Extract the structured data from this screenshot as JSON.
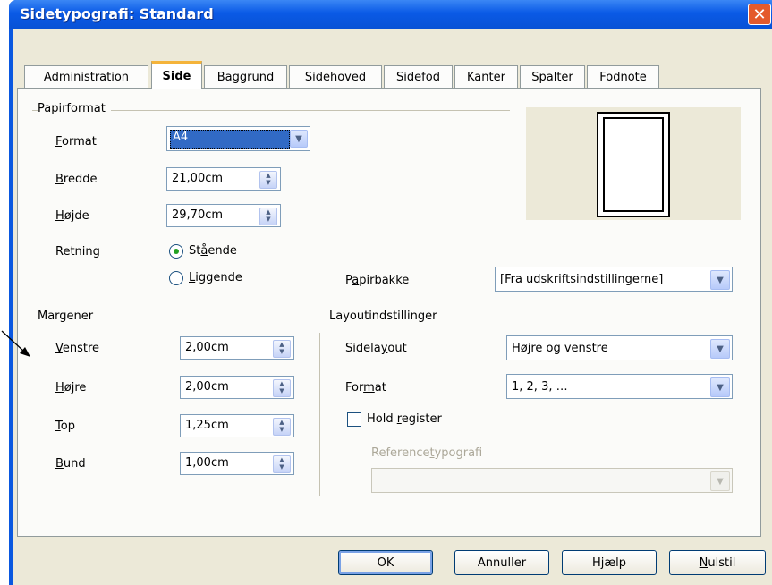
{
  "window": {
    "title": "Sidetypografi: Standard",
    "close_glyph": "✕"
  },
  "tabs": [
    {
      "label": "Administration",
      "active": false
    },
    {
      "label": "Side",
      "active": true
    },
    {
      "label": "Baggrund",
      "active": false
    },
    {
      "label": "Sidehoved",
      "active": false
    },
    {
      "label": "Sidefod",
      "active": false
    },
    {
      "label": "Kanter",
      "active": false
    },
    {
      "label": "Spalter",
      "active": false
    },
    {
      "label": "Fodnote",
      "active": false
    }
  ],
  "papirformat": {
    "title": "Papirformat",
    "format": {
      "acc": "F",
      "rest": "ormat",
      "value": "A4"
    },
    "bredde": {
      "acc": "B",
      "rest": "redde",
      "value": "21,00cm"
    },
    "hojde": {
      "acc": "H",
      "rest": "øjde",
      "value": "29,70cm"
    },
    "retning": {
      "label": "Retning",
      "staende": {
        "pre": "St",
        "acc": "å",
        "post": "ende",
        "selected": true
      },
      "liggende": {
        "acc": "L",
        "rest": "iggende",
        "selected": false
      }
    },
    "papirbakke": {
      "pre": "P",
      "acc": "a",
      "post": "pirbakke",
      "value": "[Fra udskriftsindstillingerne]"
    }
  },
  "margener": {
    "title": "Margener",
    "venstre": {
      "acc": "V",
      "rest": "enstre",
      "value": "2,00cm"
    },
    "hojre": {
      "acc": "H",
      "rest": "øjre",
      "value": "2,00cm"
    },
    "top": {
      "acc": "T",
      "rest": "op",
      "value": "1,25cm"
    },
    "bund": {
      "acc": "B",
      "rest": "und",
      "value": "1,00cm"
    }
  },
  "layout": {
    "title": "Layoutindstillinger",
    "sidelayout": {
      "pre": "Sidela",
      "acc": "y",
      "post": "out",
      "value": "Højre og venstre"
    },
    "format": {
      "pre": "For",
      "acc": "m",
      "post": "at",
      "value": "1, 2, 3, …"
    },
    "hold_register": {
      "pre": "Hold ",
      "acc": "r",
      "post": "egister",
      "checked": false
    },
    "referencetypografi": {
      "pre": "Reference",
      "acc": "t",
      "post": "ypografi",
      "value": ""
    }
  },
  "buttons": {
    "ok": "OK",
    "annuller": "Annuller",
    "hjaelp": {
      "pre": "H",
      "acc": "j",
      "post": "ælp"
    },
    "nulstil": {
      "acc": "N",
      "rest": "ulstil"
    }
  },
  "icons": {
    "spin": "spin-updown-icon",
    "dropdown": "chevron-down-icon"
  },
  "colors": {
    "titlebar": "#0a5ae6",
    "dialog_bg": "#ece9d8",
    "active_tab_accent": "#f4b33a",
    "selection": "#316ac5"
  }
}
